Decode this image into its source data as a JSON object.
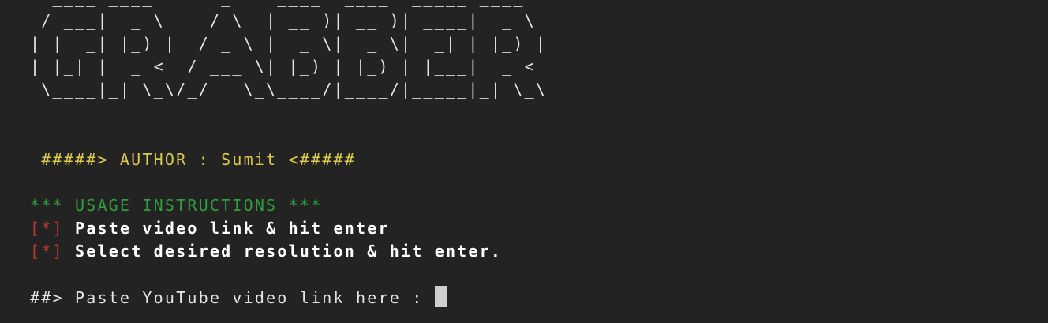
{
  "banner_ascii": [
    "  ____ ____      _    ____  ____  _____ ____",
    " / ___|  _ \\    / \\  | __ )| __ )| ____|  _ \\",
    "| |  _| |_) |  / _ \\ |  _ \\|  _ \\|  _| | |_) |",
    "| |_| |  _ <  / ___ \\| |_) | |_) | |___|  _ <",
    " \\____|_| \\_\\/_/   \\_\\____/|____/|_____|_| \\_\\"
  ],
  "author_line": " #####> AUTHOR : Sumit <#####",
  "usage_heading": "*** USAGE INSTRUCTIONS ***",
  "instructions": [
    {
      "bullet": "[*]",
      "text": "Paste video link & hit enter"
    },
    {
      "bullet": "[*]",
      "text": "Select desired resolution & hit enter."
    }
  ],
  "prompt_text": "##> Paste YouTube video link here : ",
  "input_value": "",
  "colors": {
    "background": "#232323",
    "author": "#d9c94a",
    "usage": "#2e9f3a",
    "bullet": "#b63a32",
    "text": "#e6e6e6"
  }
}
